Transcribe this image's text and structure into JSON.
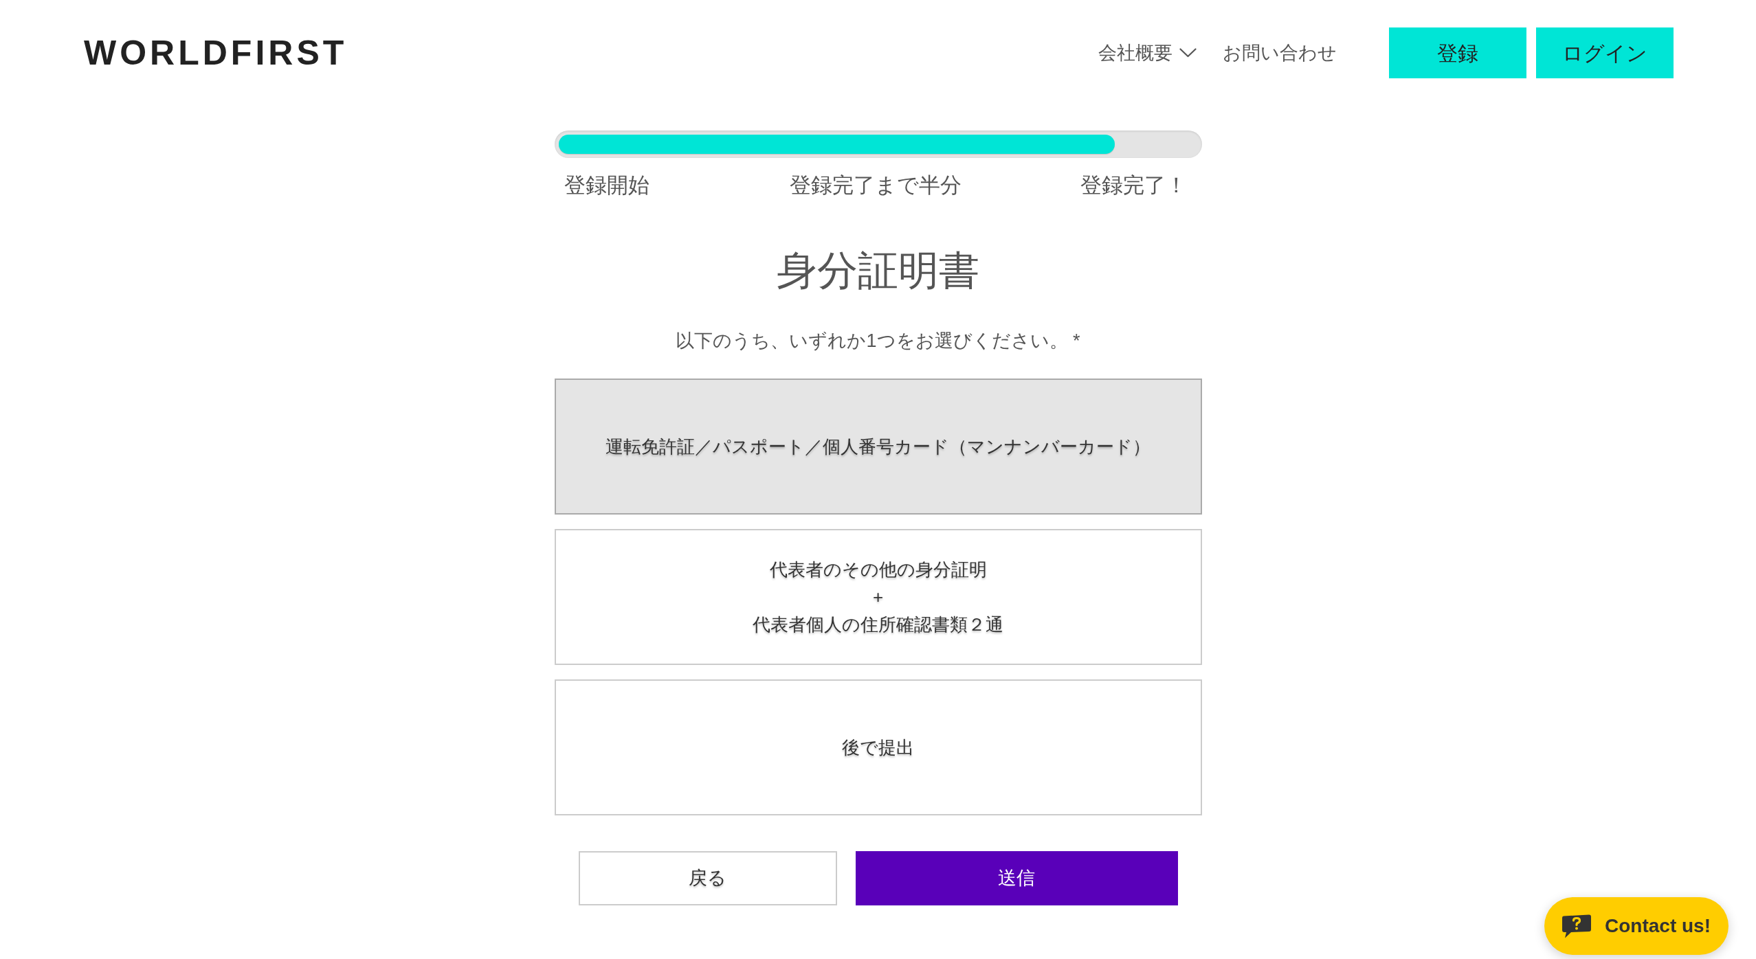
{
  "header": {
    "logo": "WORLDFIRST",
    "nav": [
      {
        "label": "会社概要",
        "kind": "dropdown"
      },
      {
        "label": "お問い合わせ",
        "kind": "link"
      }
    ],
    "buttons": [
      "登録",
      "ログイン"
    ]
  },
  "progress": {
    "level": 0.87,
    "steps": [
      "登録開始",
      "登録完了まで半分",
      "登録完了！"
    ]
  },
  "title": "身分証明書",
  "prompt": "以下のうち、いずれか1つをお選びください。 *",
  "options": [
    {
      "lines": [
        "運転免許証／パスポート／個人番号カード（マンナンバーカード）"
      ],
      "selected": true
    },
    {
      "lines": [
        "代表者のその他の身分証明",
        "+",
        "代表者個人の住所確認書類２通"
      ],
      "selected": false
    },
    {
      "lines": [
        "後で提出"
      ],
      "selected": false
    }
  ],
  "actions": [
    {
      "label": "戻る",
      "kind": "back"
    },
    {
      "label": "送信",
      "kind": "submit"
    }
  ],
  "contact_button": {
    "label": "Contact us!"
  }
}
